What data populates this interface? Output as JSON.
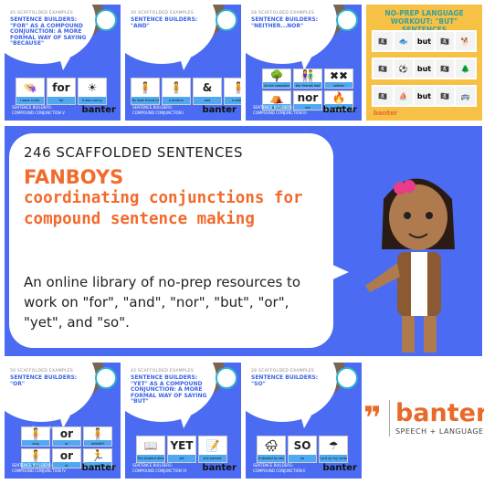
{
  "tiles": [
    {
      "count": "45 SCAFFOLDED EXAMPLES",
      "title": "Sentence builders: \"for\" as a compound conjunction: a more formal way of saying \"because\"",
      "cards": [
        {
          "pic": "👒",
          "cap": "I wore a hat."
        },
        {
          "pic": "for",
          "cap": "for"
        },
        {
          "pic": "☀",
          "cap": "it was sunny."
        }
      ],
      "foot1": "Sentence builders:",
      "foot2": "Compound conjunction V",
      "brand": "banter"
    },
    {
      "count": "30 SCAFFOLDED EXAMPLES",
      "title": "Sentence builders: \"and\"",
      "cards": [
        {
          "pic": "🧍",
          "cap": "My best friend has"
        },
        {
          "pic": "🧍",
          "cap": "a brother"
        },
        {
          "pic": "&",
          "cap": "and"
        },
        {
          "pic": "🧍",
          "cap": "a sister."
        }
      ],
      "foot1": "Sentence builders:",
      "foot2": "Compound conjunction I",
      "brand": "banter"
    },
    {
      "count": "28 SCAFFOLDED EXAMPLES",
      "title": "Sentence builders: \"neither...nor\"",
      "cards": [
        {
          "pic": "🌳",
          "cap": "At the campsite"
        },
        {
          "pic": "👫",
          "cap": "the friends had"
        },
        {
          "pic": "✖✖",
          "cap": "neither"
        },
        {
          "pic": "⛺",
          "cap": "a tent"
        },
        {
          "pic": "nor",
          "cap": "nor"
        },
        {
          "pic": "🔥",
          "cap": "a fire."
        }
      ],
      "foot1": "Sentence builders:",
      "foot2": "Compound conjunction III",
      "brand": "banter"
    },
    {
      "count": "50 SCAFFOLDED EXAMPLES",
      "title": "Sentence builders: \"or\"",
      "prompt": "Do you like to:",
      "cards": [
        {
          "pic": "🧍",
          "cap": "sing"
        },
        {
          "pic": "or",
          "cap": "or"
        },
        {
          "pic": "🧍",
          "cap": "whistle?"
        },
        {
          "pic": "🧍",
          "cap": "walk"
        },
        {
          "pic": "or",
          "cap": "or"
        },
        {
          "pic": "🏃",
          "cap": "run?"
        }
      ],
      "foot1": "Sentence builders:",
      "foot2": "Compound conjunction IV",
      "brand": "banter"
    },
    {
      "count": "42 SCAFFOLDED EXAMPLES",
      "title": "Sentence builders: \"yet\" as a compound conjunction: a more formal way of saying \"but\"",
      "cards": [
        {
          "pic": "📖",
          "cap": "The student didn't study for the test,"
        },
        {
          "pic": "YET",
          "cap": "yet"
        },
        {
          "pic": "📝",
          "cap": "she passed."
        }
      ],
      "foot1": "Sentence builders:",
      "foot2": "Compound conjunction VI",
      "brand": "banter"
    },
    {
      "count": "28 SCAFFOLDED EXAMPLES",
      "title": "Sentence builders: \"so\"",
      "cards": [
        {
          "pic": "🌧",
          "cap": "It started to rain"
        },
        {
          "pic": "SO",
          "cap": "so"
        },
        {
          "pic": "☂",
          "cap": "I put up my umbrella."
        }
      ],
      "foot1": "Sentence builders:",
      "foot2": "Compound conjunction II",
      "brand": "banter"
    }
  ],
  "workout": {
    "title": "NO-PREP LANGUAGE WORKOUT: \"BUT\" SENTENCES",
    "rows": [
      [
        "🏴‍☠",
        "🐟",
        "but",
        "🏴‍☠",
        "🐕"
      ],
      [
        "🏴‍☠",
        "⚽",
        "but",
        "🏴‍☠",
        "🌲"
      ],
      [
        "🏴‍☠",
        "⛵",
        "but",
        "🏴‍☠",
        "🚌"
      ]
    ],
    "brand": "banter"
  },
  "banner": {
    "count": "246 SCAFFOLDED SENTENCES",
    "headline": "FANBOYS",
    "subhead": "coordinating conjunctions for compound sentence making",
    "body": "An online library of no-prep resources to work on \"for\", \"and\", \"nor\", \"but\", \"or\", \"yet\", and \"so\"."
  },
  "brand": {
    "name": "banter",
    "tagline": "SPEECH + LANGUAGE"
  },
  "colors": {
    "blue": "#4b6cf2",
    "orange": "#f26a2c",
    "yellow": "#f7c145"
  }
}
